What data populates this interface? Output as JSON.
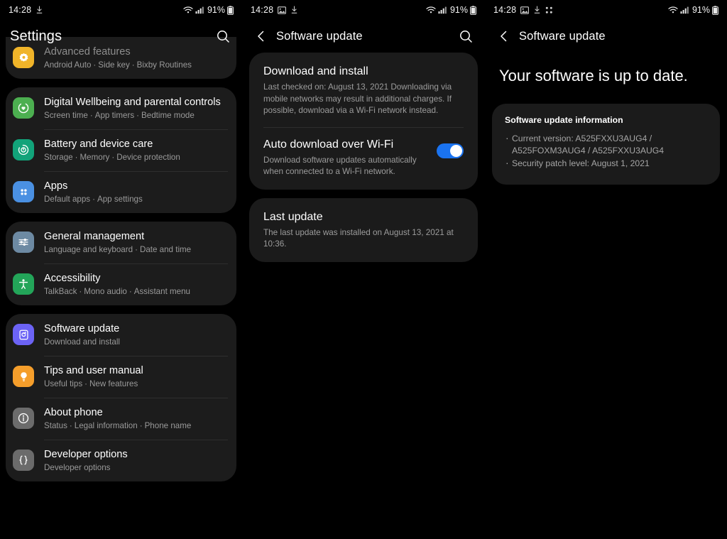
{
  "statusbar": {
    "time": "14:28",
    "battery_pct": "91%",
    "icons_left_panel1": [
      "download-icon"
    ],
    "icons_left_panel2": [
      "image-icon",
      "download-icon"
    ],
    "icons_left_panel3": [
      "image-icon",
      "download-icon",
      "apps-grid-icon"
    ],
    "icons_right": [
      "wifi-icon",
      "signal-icon",
      "battery-icon"
    ]
  },
  "panel1": {
    "header_title": "Settings",
    "groups": [
      {
        "clipped": true,
        "rows": [
          {
            "title": "Advanced features",
            "subtitle_parts": [
              "Android Auto",
              "Side key",
              "Bixby Routines"
            ],
            "icon": "advanced-features-icon",
            "icon_color": "#f0b429"
          }
        ]
      },
      {
        "clipped": false,
        "rows": [
          {
            "title": "Digital Wellbeing and parental controls",
            "subtitle_parts": [
              "Screen time",
              "App timers",
              "Bedtime mode"
            ],
            "icon": "digital-wellbeing-icon",
            "icon_color": "#4caf50"
          },
          {
            "title": "Battery and device care",
            "subtitle_parts": [
              "Storage",
              "Memory",
              "Device protection"
            ],
            "icon": "battery-device-care-icon",
            "icon_color": "#12a37a"
          },
          {
            "title": "Apps",
            "subtitle_parts": [
              "Default apps",
              "App settings"
            ],
            "icon": "apps-icon",
            "icon_color": "#4a90e2"
          }
        ]
      },
      {
        "clipped": false,
        "rows": [
          {
            "title": "General management",
            "subtitle_parts": [
              "Language and keyboard",
              "Date and time"
            ],
            "icon": "general-management-icon",
            "icon_color": "#6d8aa3"
          },
          {
            "title": "Accessibility",
            "subtitle_parts": [
              "TalkBack",
              "Mono audio",
              "Assistant menu"
            ],
            "icon": "accessibility-icon",
            "icon_color": "#23a559"
          }
        ]
      },
      {
        "clipped": false,
        "rows": [
          {
            "title": "Software update",
            "subtitle_parts": [
              "Download and install"
            ],
            "icon": "software-update-icon",
            "icon_color": "#6c63f5"
          },
          {
            "title": "Tips and user manual",
            "subtitle_parts": [
              "Useful tips",
              "New features"
            ],
            "icon": "tips-icon",
            "icon_color": "#f59e2b"
          },
          {
            "title": "About phone",
            "subtitle_parts": [
              "Status",
              "Legal information",
              "Phone name"
            ],
            "icon": "about-phone-icon",
            "icon_color": "#6b6b6b"
          },
          {
            "title": "Developer options",
            "subtitle_parts": [
              "Developer options"
            ],
            "icon": "developer-options-icon",
            "icon_color": "#6b6b6b"
          }
        ]
      }
    ]
  },
  "panel2": {
    "header_title": "Software update",
    "sections": [
      {
        "title": "Download and install",
        "body": "Last checked on: August 13, 2021\nDownloading via mobile networks may result in additional charges. If possible, download via a Wi-Fi network instead."
      },
      {
        "title": "Auto download over Wi-Fi",
        "body": "Download software updates automatically when connected to a Wi-Fi network.",
        "toggle": {
          "state": "on",
          "on_color": "#1a73f0"
        }
      }
    ],
    "last_update": {
      "title": "Last update",
      "body": "The last update was installed on August 13, 2021 at 10:36."
    }
  },
  "panel3": {
    "header_title": "Software update",
    "status_message": "Your software is up to date.",
    "info_heading": "Software update information",
    "info_items": [
      "Current version: A525FXXU3AUG4 / A525FOXM3AUG4 / A525FXXU3AUG4",
      "Security patch level: August 1, 2021"
    ]
  }
}
